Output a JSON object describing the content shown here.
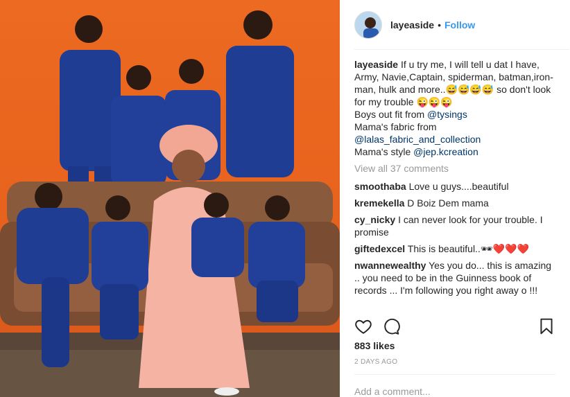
{
  "post": {
    "username": "layeaside",
    "separator": "•",
    "follow_label": "Follow"
  },
  "caption": {
    "username": "layeaside",
    "lines": [
      "If u try me, I will tell u dat I have, Army, Navie,Captain, spiderman, batman,iron-man, hulk and more..😅😅😅😅 so don't look for my trouble 😜😜😜",
      "Boys out fit from ",
      "Mama's fabric from ",
      "Mama's style "
    ],
    "mentions": [
      "@tysings",
      "@lalas_fabric_and_collection",
      "@jep.kcreation"
    ]
  },
  "view_all_comments": "View all 37 comments",
  "comments": [
    {
      "user": "smoothaba",
      "text": "Love u guys....beautiful"
    },
    {
      "user": "kremekella",
      "text": "D Boiz Dem mama"
    },
    {
      "user": "cy_nicky",
      "text": "I can never look for your trouble. I promise"
    },
    {
      "user": "giftedexcel",
      "text": "This is beautiful..🕶❤️❤️❤️"
    },
    {
      "user": "nwannewealthy",
      "text": "Yes you do... this is amazing .. you need to be in the Guinness book of records ... I'm following you right away o !!!"
    }
  ],
  "likes": "883 likes",
  "posted_time": "2 DAYS AGO",
  "add_comment_placeholder": "Add a comment...",
  "icons": {
    "like": "heart-outline-icon",
    "comment": "speech-bubble-icon",
    "save": "bookmark-icon"
  },
  "colors": {
    "link_blue": "#3897f0",
    "mention": "#003569",
    "backdrop_orange": "#ec6a22",
    "outfit_blue": "#1f3d93",
    "dress_pink": "#f5b3a4"
  }
}
